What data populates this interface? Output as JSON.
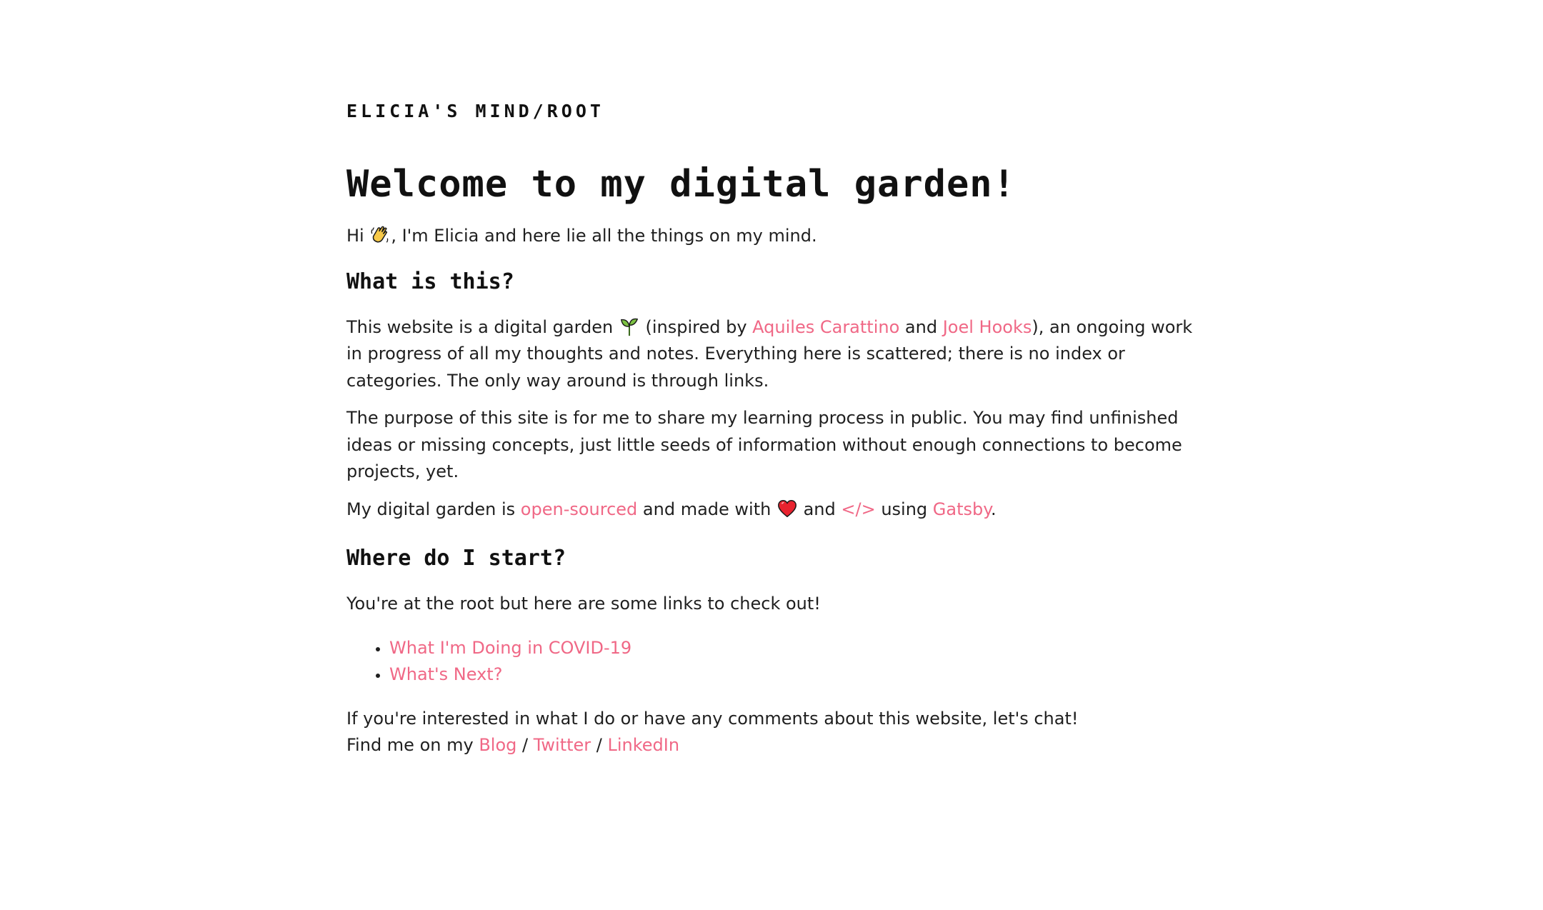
{
  "site": {
    "title": "ELICIA'S MIND/ROOT"
  },
  "main": {
    "heading": "Welcome to my digital garden!",
    "intro": {
      "before_icon": "Hi ",
      "icon": "waving-hand-icon",
      "after_icon": ", I'm Elicia and here lie all the things on my mind."
    },
    "what_section": {
      "heading": "What is this?",
      "garden": {
        "text1": "This website is a digital garden ",
        "icon": "seedling-icon",
        "text2": " (inspired by ",
        "link1": "Aquiles Carattino",
        "text3": " and ",
        "link2": "Joel Hooks",
        "text4": "), an ongoing work in progress of all my thoughts and notes. Everything here is scattered; there is no index or categories. The only way around is through links."
      },
      "purpose": "The purpose of this site is for me to share my learning process in public. You may find unfinished ideas or missing concepts, just little seeds of information without enough connections to become projects, yet.",
      "source": {
        "text1": "My digital garden is ",
        "link_open": "open-sourced",
        "text2": " and made with ",
        "icon": "red-heart-icon",
        "text3": " and ",
        "code": "</>",
        "text4": " using ",
        "link_gatsby": "Gatsby",
        "text5": "."
      }
    },
    "start_section": {
      "heading": "Where do I start?",
      "intro": "You're at the root but here are some links to check out!",
      "links": [
        "What I'm Doing in COVID-19",
        "What's Next?"
      ],
      "chat_line": "If you're interested in what I do or have any comments about this website, let's chat!",
      "find_me": {
        "text": "Find me on my ",
        "blog": "Blog",
        "sep1": " / ",
        "twitter": "Twitter",
        "sep2": " / ",
        "linkedin": "LinkedIn"
      }
    }
  },
  "colors": {
    "link": "#f06886",
    "text": "#1f1f1f",
    "heading": "#111111",
    "background": "#ffffff"
  }
}
